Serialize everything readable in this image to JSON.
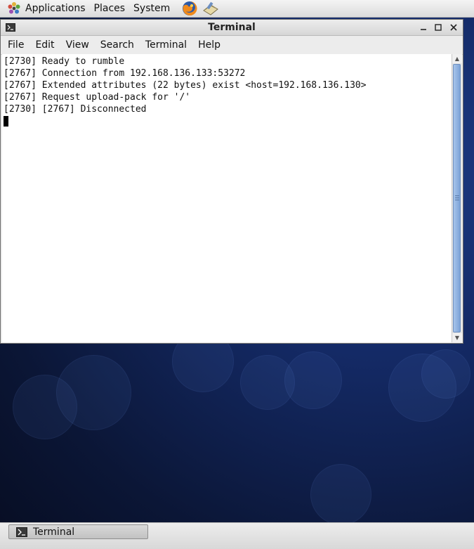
{
  "top_panel": {
    "applications": "Applications",
    "places": "Places",
    "system": "System",
    "launchers": [
      {
        "name": "firefox-icon"
      },
      {
        "name": "notes-icon"
      }
    ]
  },
  "window": {
    "title": "Terminal",
    "controls": {
      "minimize": "_",
      "maximize": "□",
      "close": "✕"
    }
  },
  "menubar": {
    "items": [
      "File",
      "Edit",
      "View",
      "Search",
      "Terminal",
      "Help"
    ]
  },
  "terminal": {
    "lines": [
      "[2730] Ready to rumble",
      "[2767] Connection from 192.168.136.133:53272",
      "[2767] Extended attributes (22 bytes) exist <host=192.168.136.130>",
      "[2767] Request upload-pack for '/'",
      "[2730] [2767] Disconnected"
    ]
  },
  "taskbar": {
    "items": [
      {
        "label": "Terminal",
        "icon": "terminal-icon"
      }
    ]
  },
  "colors": {
    "desktop": "#142a66",
    "scroll_thumb": "#7ea4d8",
    "terminal_bg": "#ffffff"
  }
}
